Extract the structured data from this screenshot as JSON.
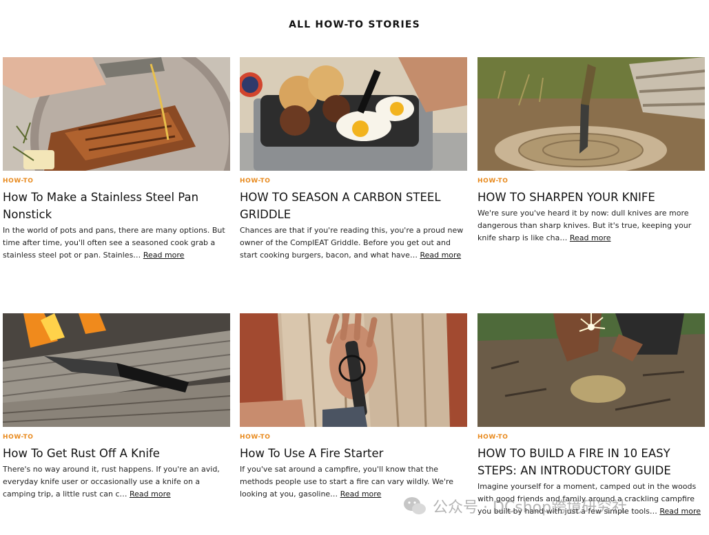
{
  "section": {
    "title": "ALL HOW-TO STORIES"
  },
  "cards": [
    {
      "category": "HOW-TO",
      "title": "How To Make a Stainless Steel Pan Nonstick",
      "excerpt": "In the world of pots and pans, there are many options. But time after time, you'll often see a seasoned cook grab a stainless steel pot or pan. Stainles…",
      "read_more": "Read more",
      "image_icon": "salmon-pan-photo"
    },
    {
      "category": "HOW-TO",
      "title": "HOW TO SEASON A CARBON STEEL GRIDDLE",
      "excerpt": "Chances are that if you're reading this, you're a proud new owner of the ComplEAT Griddle. Before you get out and start cooking burgers, bacon, and what have…",
      "read_more": "Read more",
      "image_icon": "griddle-photo"
    },
    {
      "category": "HOW-TO",
      "title": "HOW TO SHARPEN YOUR KNIFE",
      "excerpt": "We're sure you've heard it by now: dull knives are more dangerous than sharp knives. But it's true, keeping your knife sharp is like cha…",
      "read_more": "Read more",
      "image_icon": "knife-stump-photo"
    },
    {
      "category": "HOW-TO",
      "title": "How To Get Rust Off A Knife",
      "excerpt": "There's no way around it, rust happens. If you're an avid, everyday knife user or occasionally use a knife on a camping trip, a little rust can c…",
      "read_more": "Read more",
      "image_icon": "knife-log-photo"
    },
    {
      "category": "HOW-TO",
      "title": "How To Use A Fire Starter",
      "excerpt": "If you've sat around a campfire, you'll know that the methods people use to start a fire can vary wildly. We're looking at you, gasoline…",
      "read_more": "Read more",
      "image_icon": "fire-starter-photo"
    },
    {
      "category": "HOW-TO",
      "title": "HOW TO BUILD A FIRE IN 10 EASY STEPS: AN INTRODUCTORY GUIDE",
      "excerpt": "Imagine yourself for a moment, camped out in the woods with good friends and family around a crackling campfire you built by hand with just a few simple tools…",
      "read_more": "Read more",
      "image_icon": "spark-photo"
    }
  ],
  "watermark": {
    "text": "公众号 · DCshop跨境研究社",
    "icon": "wechat-icon"
  },
  "colors": {
    "category": "#e8891c",
    "title": "#111111",
    "text": "#222222"
  }
}
